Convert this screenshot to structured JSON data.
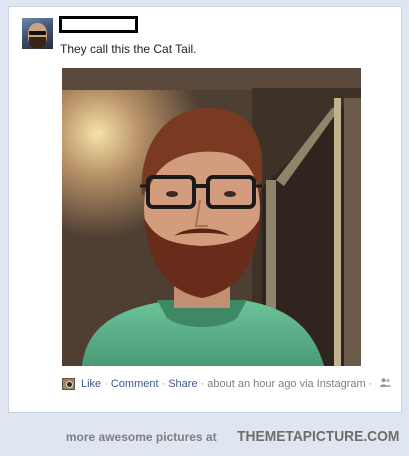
{
  "post": {
    "text": "They call this the Cat Tail."
  },
  "footer": {
    "like": "Like",
    "comment": "Comment",
    "share": "Share",
    "time": "about an hour ago via Instagram",
    "sep": "·"
  },
  "icons": {
    "app": "instagram-icon",
    "audience": "people-icon"
  },
  "watermark": {
    "more": "more awesome pictures at",
    "brand": "THEMETAPICTURE.COM"
  },
  "colors": {
    "link": "#3b5998",
    "page_bg": "#dfe6f1",
    "shirt": "#5fae8a"
  }
}
